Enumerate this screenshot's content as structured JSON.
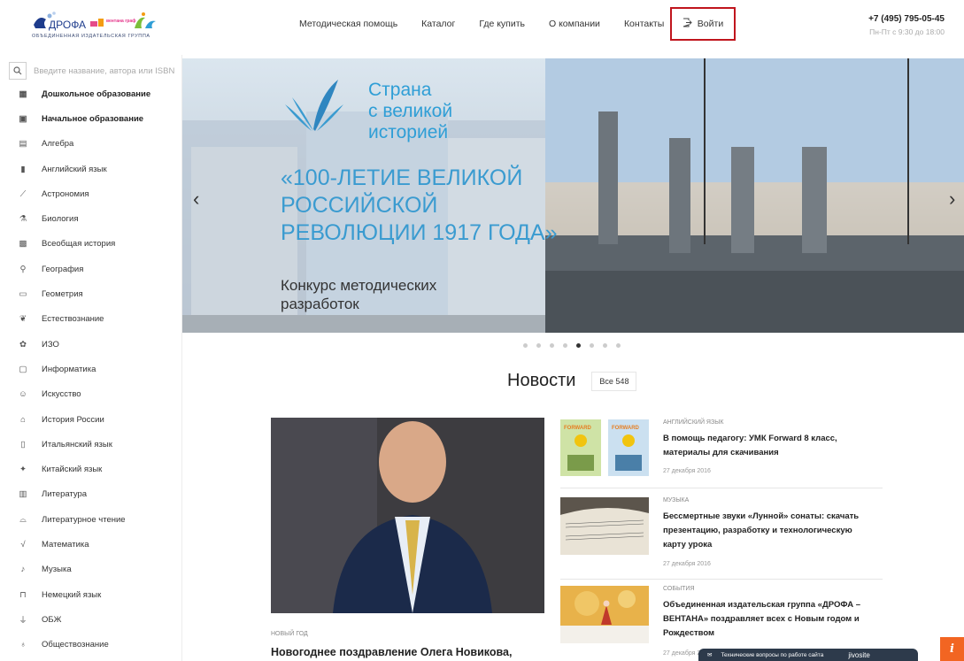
{
  "header": {
    "logo_subtitle": "ОБЪЕДИНЕННАЯ ИЗДАТЕЛЬСКАЯ ГРУППА",
    "logo_drofa": "ДРОФА",
    "logo_ventana": "вентана граф",
    "nav": [
      "Методическая помощь",
      "Каталог",
      "Где купить",
      "О компании",
      "Контакты"
    ],
    "login_label": "Войти",
    "phone": "+7 (495) 795-05-45",
    "hours": "Пн-Пт с 9:30 до 18:00"
  },
  "sidebar": {
    "search_placeholder": "Введите название, автора или ISBN",
    "subjects": [
      {
        "label": "Дошкольное образование",
        "icon": "preschool-blocks-icon",
        "bold": true
      },
      {
        "label": "Начальное образование",
        "icon": "school-bag-icon",
        "bold": true
      },
      {
        "label": "Алгебра",
        "icon": "algebra-grid-icon"
      },
      {
        "label": "Английский язык",
        "icon": "phone-booth-icon"
      },
      {
        "label": "Астрономия",
        "icon": "telescope-icon"
      },
      {
        "label": "Биология",
        "icon": "microscope-icon"
      },
      {
        "label": "Всеобщая история",
        "icon": "world-history-icon"
      },
      {
        "label": "География",
        "icon": "map-pin-icon"
      },
      {
        "label": "Геометрия",
        "icon": "ruler-icon"
      },
      {
        "label": "Естествознание",
        "icon": "nature-icon"
      },
      {
        "label": "ИЗО",
        "icon": "palette-icon"
      },
      {
        "label": "Информатика",
        "icon": "monitor-icon"
      },
      {
        "label": "Искусство",
        "icon": "theatre-icon"
      },
      {
        "label": "История России",
        "icon": "museum-icon"
      },
      {
        "label": "Итальянский язык",
        "icon": "italian-icon"
      },
      {
        "label": "Китайский язык",
        "icon": "chinese-icon"
      },
      {
        "label": "Литература",
        "icon": "book-shelf-icon"
      },
      {
        "label": "Литературное чтение",
        "icon": "open-book-icon"
      },
      {
        "label": "Математика",
        "icon": "square-root-icon"
      },
      {
        "label": "Музыка",
        "icon": "metronome-icon"
      },
      {
        "label": "Немецкий язык",
        "icon": "gate-icon"
      },
      {
        "label": "ОБЖ",
        "icon": "fire-extinguisher-icon"
      },
      {
        "label": "Обществознание",
        "icon": "people-icon"
      }
    ]
  },
  "banner": {
    "title": "Страна\nс великой\nисторией",
    "headline": "«100-летие великой российской революции 1917 года»",
    "subtitle": "Конкурс методических разработок",
    "slide_count": 8,
    "active_slide": 4
  },
  "news": {
    "title": "Новости",
    "all_label": "Все 548",
    "main": {
      "category": "НОВЫЙ ГОД",
      "headline": "Новогоднее поздравление Олега Новикова,"
    },
    "items": [
      {
        "category": "АНГЛИЙСКИЙ ЯЗЫК",
        "text": "В помощь педагогу: УМК Forward 8 класс, материалы для скачивания",
        "date": "27 декабря 2016",
        "thumb_label": "FORWARD"
      },
      {
        "category": "МУЗЫКА",
        "text": "Бессмертные звуки «Лунной» сонаты: скачать презентацию, разработку и технологическую карту урока",
        "date": "27 декабря 2016"
      },
      {
        "category": "СОБЫТИЯ",
        "text": "Объединенная издательская группа «ДРОФА – ВЕНТАНА» поздравляет всех с Новым годом и Рождеством",
        "date": "27 декабря 2016"
      }
    ]
  },
  "support": {
    "label": "Технические вопросы по работе сайта",
    "brand": "jivosite"
  },
  "colors": {
    "accent_red": "#c0151d",
    "banner_blue": "#3a9bd0",
    "info_orange": "#f26522"
  }
}
